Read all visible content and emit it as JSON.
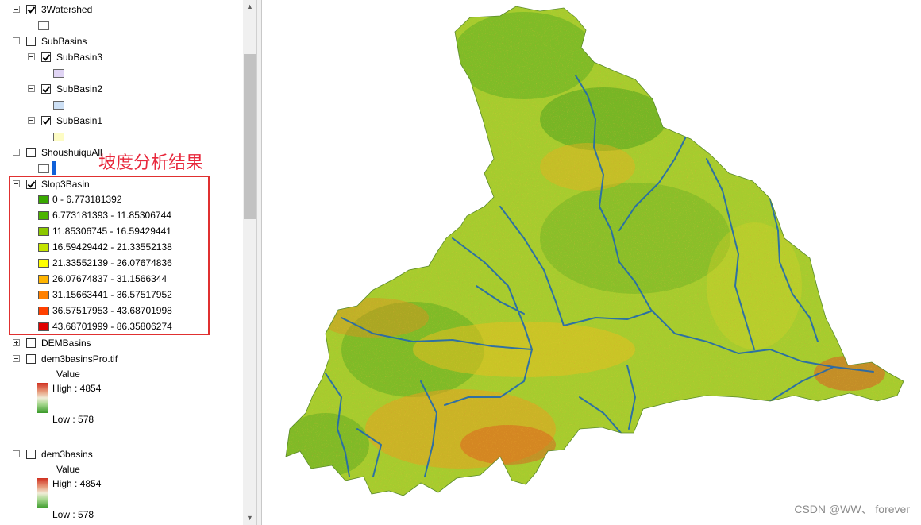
{
  "toc": {
    "layers": {
      "watershed": "3Watershed",
      "subbasins": "SubBasins",
      "subbasin3": "SubBasin3",
      "subbasin2": "SubBasin2",
      "subbasin1": "SubBasin1",
      "shoushuiqu": "ShoushuiquAll",
      "slope": "Slop3Basin",
      "dembasins": "DEMBasins",
      "dem3pro": "dem3basinsPro.tif",
      "dem3": "dem3basins"
    },
    "slope_classes": [
      {
        "label": "0 - 6.773181392",
        "color": "#38a800"
      },
      {
        "label": "6.773181393 - 11.85306744",
        "color": "#4cb400"
      },
      {
        "label": "11.85306745 - 16.59429441",
        "color": "#8cc800"
      },
      {
        "label": "16.59429442 - 21.33552138",
        "color": "#c4e400"
      },
      {
        "label": "21.33552139 - 26.07674836",
        "color": "#ffff00"
      },
      {
        "label": "26.07674837 - 31.1566344",
        "color": "#ffb400"
      },
      {
        "label": "31.15663441 - 36.57517952",
        "color": "#ff8000"
      },
      {
        "label": "36.57517953 - 43.68701998",
        "color": "#ff4000"
      },
      {
        "label": "43.68701999 - 86.35806274",
        "color": "#e00000"
      }
    ],
    "dem_pro": {
      "value_label": "Value",
      "high": "High : 4854",
      "low": "Low : 578"
    },
    "dem": {
      "value_label": "Value",
      "high": "High : 4854",
      "low": "Low : 578"
    },
    "swatch_colors": {
      "watershed": "#ffffff",
      "subbasin3": "#e0d4f4",
      "subbasin2": "#cde0f5",
      "subbasin1": "#fdfcc4",
      "shoushuiqu_fill": "#ffffff",
      "shoushuiqu_line": "#1060d8"
    }
  },
  "annotation": "坡度分析结果",
  "watermark": "CSDN @WW、 forever"
}
